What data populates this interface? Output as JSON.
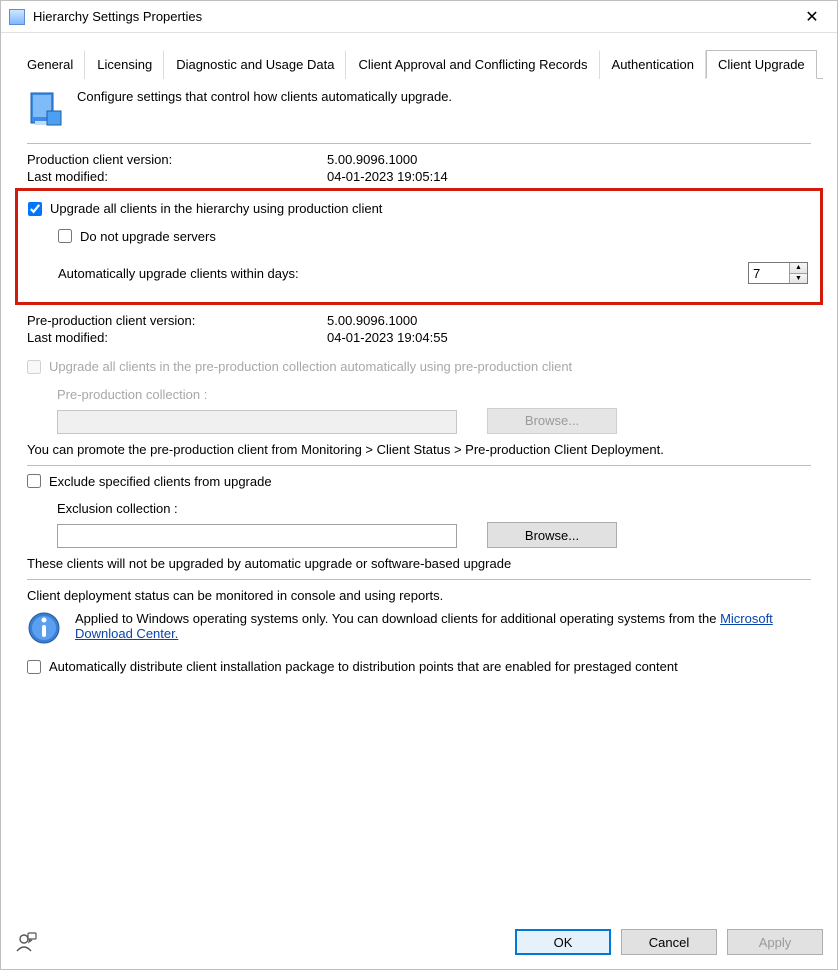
{
  "window": {
    "title": "Hierarchy Settings Properties",
    "close_glyph": "✕"
  },
  "tabs": [
    {
      "label": "General"
    },
    {
      "label": "Licensing"
    },
    {
      "label": "Diagnostic and Usage Data"
    },
    {
      "label": "Client Approval and Conflicting Records"
    },
    {
      "label": "Authentication"
    },
    {
      "label": "Client Upgrade",
      "active": true
    }
  ],
  "intro_text": "Configure settings that control how clients automatically upgrade.",
  "prod": {
    "version_label": "Production client version:",
    "version_value": "5.00.9096.1000",
    "modified_label": "Last modified:",
    "modified_value": "04-01-2023 19:05:14"
  },
  "upgrade_all": {
    "label": "Upgrade all clients in the hierarchy using production client",
    "checked": true,
    "no_servers_label": "Do not upgrade servers",
    "no_servers_checked": false,
    "days_label": "Automatically upgrade clients within days:",
    "days_value": "7"
  },
  "preprod": {
    "version_label": "Pre-production client version:",
    "version_value": "5.00.9096.1000",
    "modified_label": "Last modified:",
    "modified_value": "04-01-2023 19:04:55",
    "upgrade_all_label": "Upgrade all clients in the pre-production collection automatically using pre-production client",
    "collection_label": "Pre-production collection :",
    "collection_value": "",
    "browse_label": "Browse...",
    "promote_text": "You can promote the pre-production client from Monitoring > Client Status > Pre-production Client Deployment."
  },
  "exclude": {
    "label": "Exclude specified clients from upgrade",
    "checked": false,
    "collection_label": "Exclusion collection :",
    "collection_value": "",
    "browse_label": "Browse...",
    "note": "These clients will not be upgraded by automatic upgrade or software-based upgrade"
  },
  "deploy_status_text": "Client deployment status can be monitored in console and using reports.",
  "os_note_prefix": "Applied to Windows operating systems only. You can download clients for additional operating systems from the ",
  "os_link_text": "Microsoft Download Center.",
  "auto_distribute": {
    "label": "Automatically distribute client installation package to distribution points that are enabled for prestaged content",
    "checked": false
  },
  "buttons": {
    "ok": "OK",
    "cancel": "Cancel",
    "apply": "Apply"
  }
}
